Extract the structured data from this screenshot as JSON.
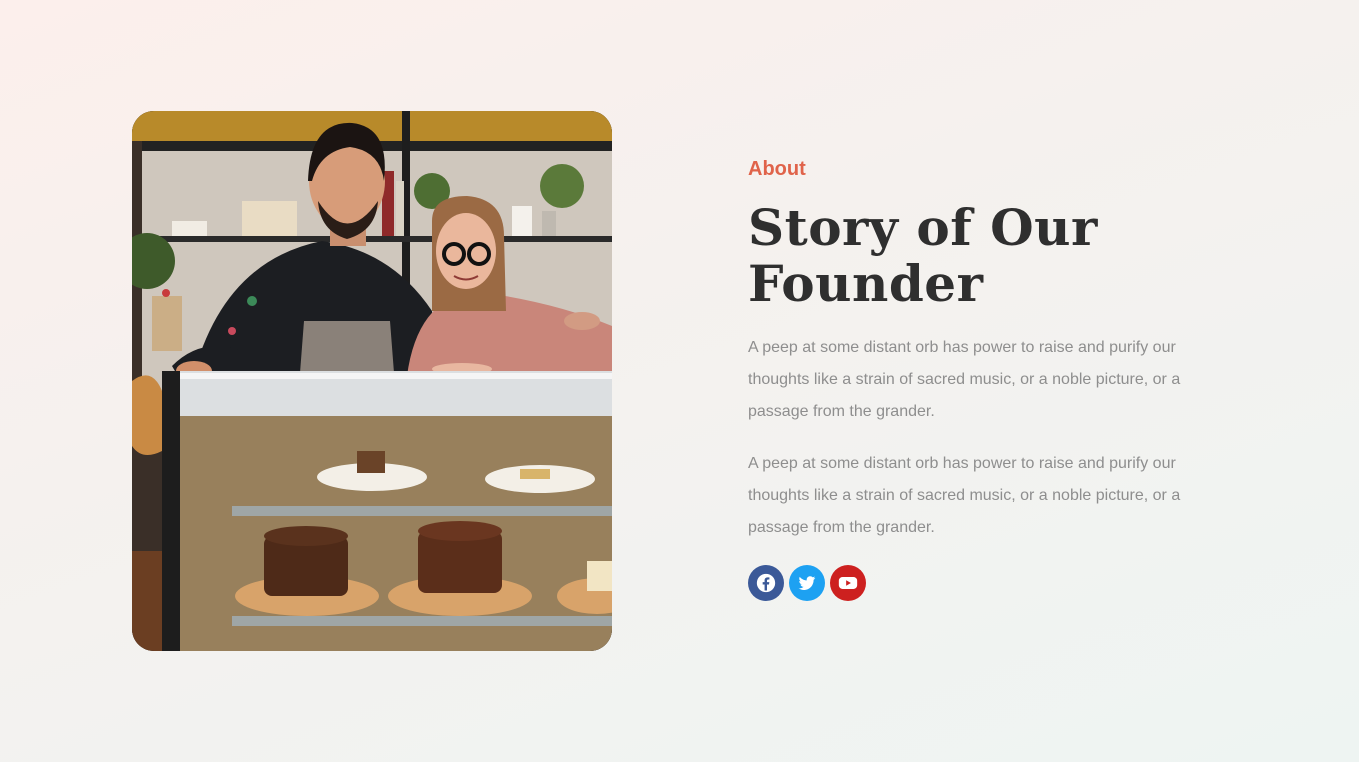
{
  "about": {
    "eyebrow": "About",
    "headline_line1": "Story of Our",
    "headline_line2": "Founder",
    "paragraphs": [
      "A peep at some distant orb has power to raise and purify our thoughts like a strain of sacred music, or a noble picture, or a passage from the grander.",
      "A peep at some distant orb has power to raise and purify our thoughts like a strain of sacred music, or a noble picture, or a passage from the grander."
    ]
  },
  "photo": {
    "subject": "founders-bakery-photo"
  },
  "social": [
    {
      "icon": "facebook-icon",
      "color": "#3b5998"
    },
    {
      "icon": "twitter-icon",
      "color": "#1da1f2"
    },
    {
      "icon": "youtube-icon",
      "color": "#cd201f"
    }
  ],
  "colors": {
    "accent": "#e0634a",
    "heading": "#2f2f2f",
    "body_text": "#8e8e8e"
  }
}
